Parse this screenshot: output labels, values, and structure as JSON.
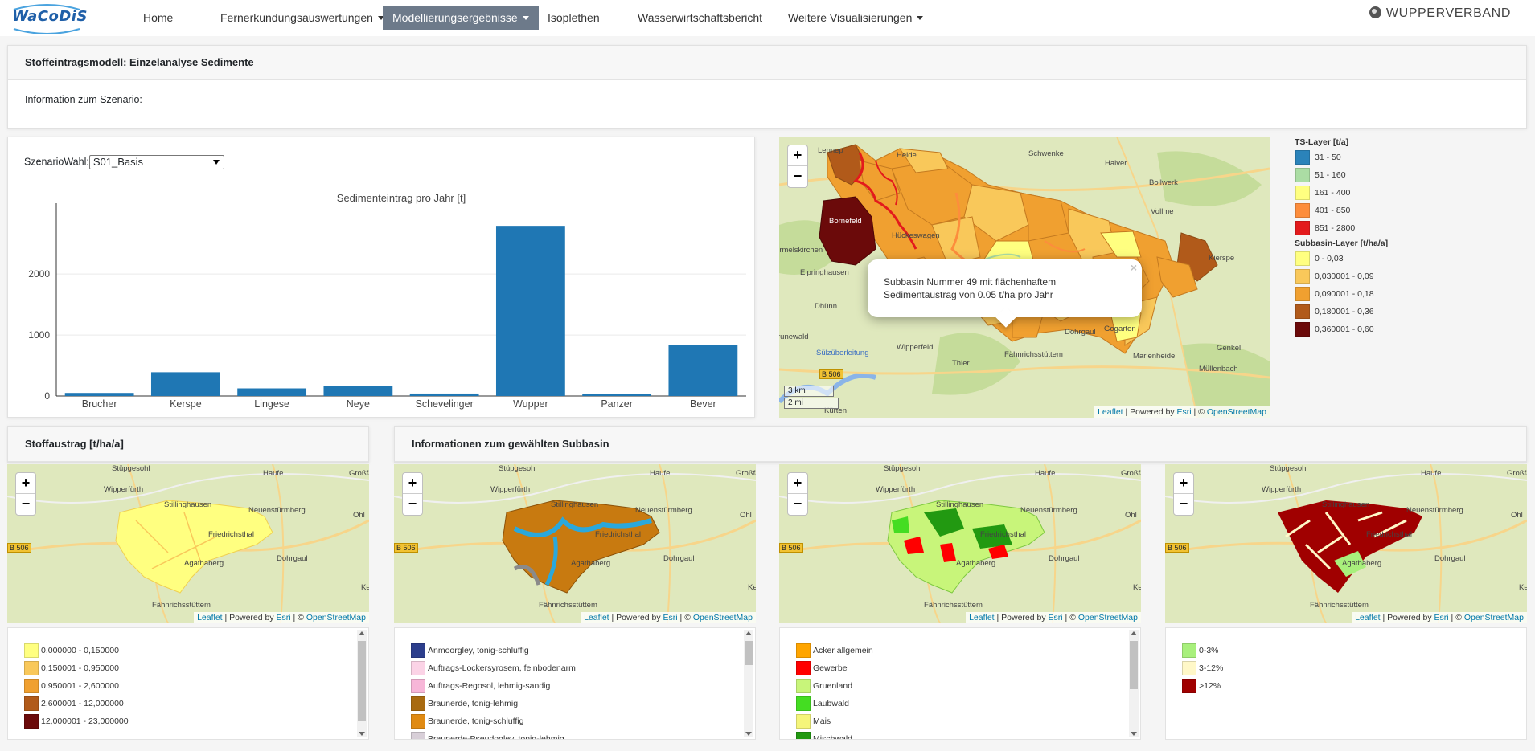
{
  "nav": {
    "logo_text": "WaCoDiS",
    "items": [
      {
        "label": "Home",
        "dropdown": false,
        "active": false
      },
      {
        "label": "Fernerkundungsauswertungen",
        "dropdown": true,
        "active": false
      },
      {
        "label": "Modellierungsergebnisse",
        "dropdown": true,
        "active": true
      },
      {
        "label": "Isoplethen",
        "dropdown": false,
        "active": false
      },
      {
        "label": "Wasserwirtschaftsbericht",
        "dropdown": false,
        "active": false
      },
      {
        "label": "Weitere Visualisierungen",
        "dropdown": true,
        "active": false
      }
    ],
    "brand": "WUPPERVERBAND"
  },
  "top_card": {
    "title": "Stoffeintragsmodell: Einzelanalyse Sedimente",
    "info": "Information zum Szenario:"
  },
  "scenario": {
    "label": "SzenarioWahl:",
    "selected": "S01_Basis"
  },
  "chart_data": {
    "type": "bar",
    "title": "Sedimenteintrag pro Jahr [t]",
    "categories": [
      "Brucher",
      "Kerspe",
      "Lingese",
      "Neye",
      "Schevelinger",
      "Wupper",
      "Panzer",
      "Bever"
    ],
    "values": [
      50,
      390,
      125,
      160,
      40,
      2790,
      30,
      840
    ],
    "yticks": [
      0,
      1000,
      2000
    ],
    "ylim": [
      0,
      2950
    ],
    "color": "#1f77b4"
  },
  "main_map": {
    "zoom_in": "+",
    "zoom_out": "−",
    "scale_km": "3 km",
    "scale_mi": "2 mi",
    "labels": [
      "Lennep",
      "Halver",
      "Schwenke",
      "Bollwerk",
      "Vollme",
      "Ermelskirchen",
      "Eipringhausen",
      "Dhünn",
      "Hückeswagen",
      "Wipperfeld",
      "Thier",
      "Fähnrichsstüttem",
      "Dohrgaul",
      "Kierspe",
      "Genkel",
      "Müllenbach",
      "Marienheide",
      "Sülzüberleitung",
      "B 506",
      "Kürten",
      "runewald",
      "Heide",
      "Bornefeld",
      "Gogarten"
    ],
    "popup": {
      "line1": "Subbasin Nummer 49 mit flächenhaftem",
      "line2": "Sedimentaustrag von 0.05 t/ha pro Jahr",
      "close": "×"
    },
    "attribution": {
      "leaflet": "Leaflet",
      "sep1": " | Powered by ",
      "esri": "Esri",
      "sep2": " | © ",
      "osm": "OpenStreetMap"
    }
  },
  "main_legend": {
    "ts_title": "TS-Layer [t/a]",
    "ts_items": [
      {
        "label": "31 - 50",
        "color": "#2b83ba"
      },
      {
        "label": "51 - 160",
        "color": "#abdda4"
      },
      {
        "label": "161 - 400",
        "color": "#ffff80"
      },
      {
        "label": "401 - 850",
        "color": "#fd8d3c"
      },
      {
        "label": "851 - 2800",
        "color": "#e31a1c"
      }
    ],
    "sub_title": "Subbasin-Layer [t/ha/a]",
    "sub_items": [
      {
        "label": "0 - 0,03",
        "color": "#ffff80"
      },
      {
        "label": "0,030001 - 0,09",
        "color": "#f9c85a"
      },
      {
        "label": "0,090001 - 0,18",
        "color": "#f0a030"
      },
      {
        "label": "0,180001 - 0,36",
        "color": "#b15a1a"
      },
      {
        "label": "0,360001 - 0,60",
        "color": "#6b0a0a"
      }
    ]
  },
  "bottom_left": {
    "title": "Stoffaustrag [t/ha/a]",
    "legend": [
      {
        "label": "0,000000 - 0,150000",
        "color": "#ffff80"
      },
      {
        "label": "0,150001 - 0,950000",
        "color": "#f9c85a"
      },
      {
        "label": "0,950001 - 2,600000",
        "color": "#f0a030"
      },
      {
        "label": "2,600001 - 12,000000",
        "color": "#b15a1a"
      },
      {
        "label": "12,000001 - 23,000000",
        "color": "#6b0a0a"
      }
    ]
  },
  "bottom_right": {
    "title": "Informationen zum gewählten Subbasin",
    "soil_legend": [
      {
        "label": "Anmoorgley, tonig-schluffig",
        "color": "#2c3e8c"
      },
      {
        "label": "Auftrags-Lockersyrosem, feinbodenarm",
        "color": "#fbd3e6"
      },
      {
        "label": "Auftrags-Regosol, lehmig-sandig",
        "color": "#f7b6d8"
      },
      {
        "label": "Braunerde, tonig-lehmig",
        "color": "#a86a10"
      },
      {
        "label": "Braunerde, tonig-schluffig",
        "color": "#e08a12"
      },
      {
        "label": "Braunerde-Pseudogley, tonig-lehmig",
        "color": "#d8cfd8"
      }
    ],
    "landuse_legend": [
      {
        "label": "Acker allgemein",
        "color": "#ffa500"
      },
      {
        "label": "Gewerbe",
        "color": "#ff0000"
      },
      {
        "label": "Gruenland",
        "color": "#c8f57a"
      },
      {
        "label": "Laubwald",
        "color": "#44dd22"
      },
      {
        "label": "Mais",
        "color": "#f5f57a"
      },
      {
        "label": "Mischwald",
        "color": "#229911"
      }
    ],
    "slope_legend": [
      {
        "label": "0-3%",
        "color": "#a8f07c"
      },
      {
        "label": "3-12%",
        "color": "#fff8c8"
      },
      {
        "label": ">12%",
        "color": "#a00000"
      }
    ]
  },
  "small_maps": {
    "labels": [
      "Wipperfürth",
      "Stillinghausen",
      "Neuenstürmberg",
      "Friedrichsthal",
      "Agathaberg",
      "Dohrgaul",
      "Fähnrichsstüttem",
      "Haufe",
      "Großfa",
      "Ohl",
      "B 506",
      "Stüpgesohl",
      "Ke"
    ]
  }
}
